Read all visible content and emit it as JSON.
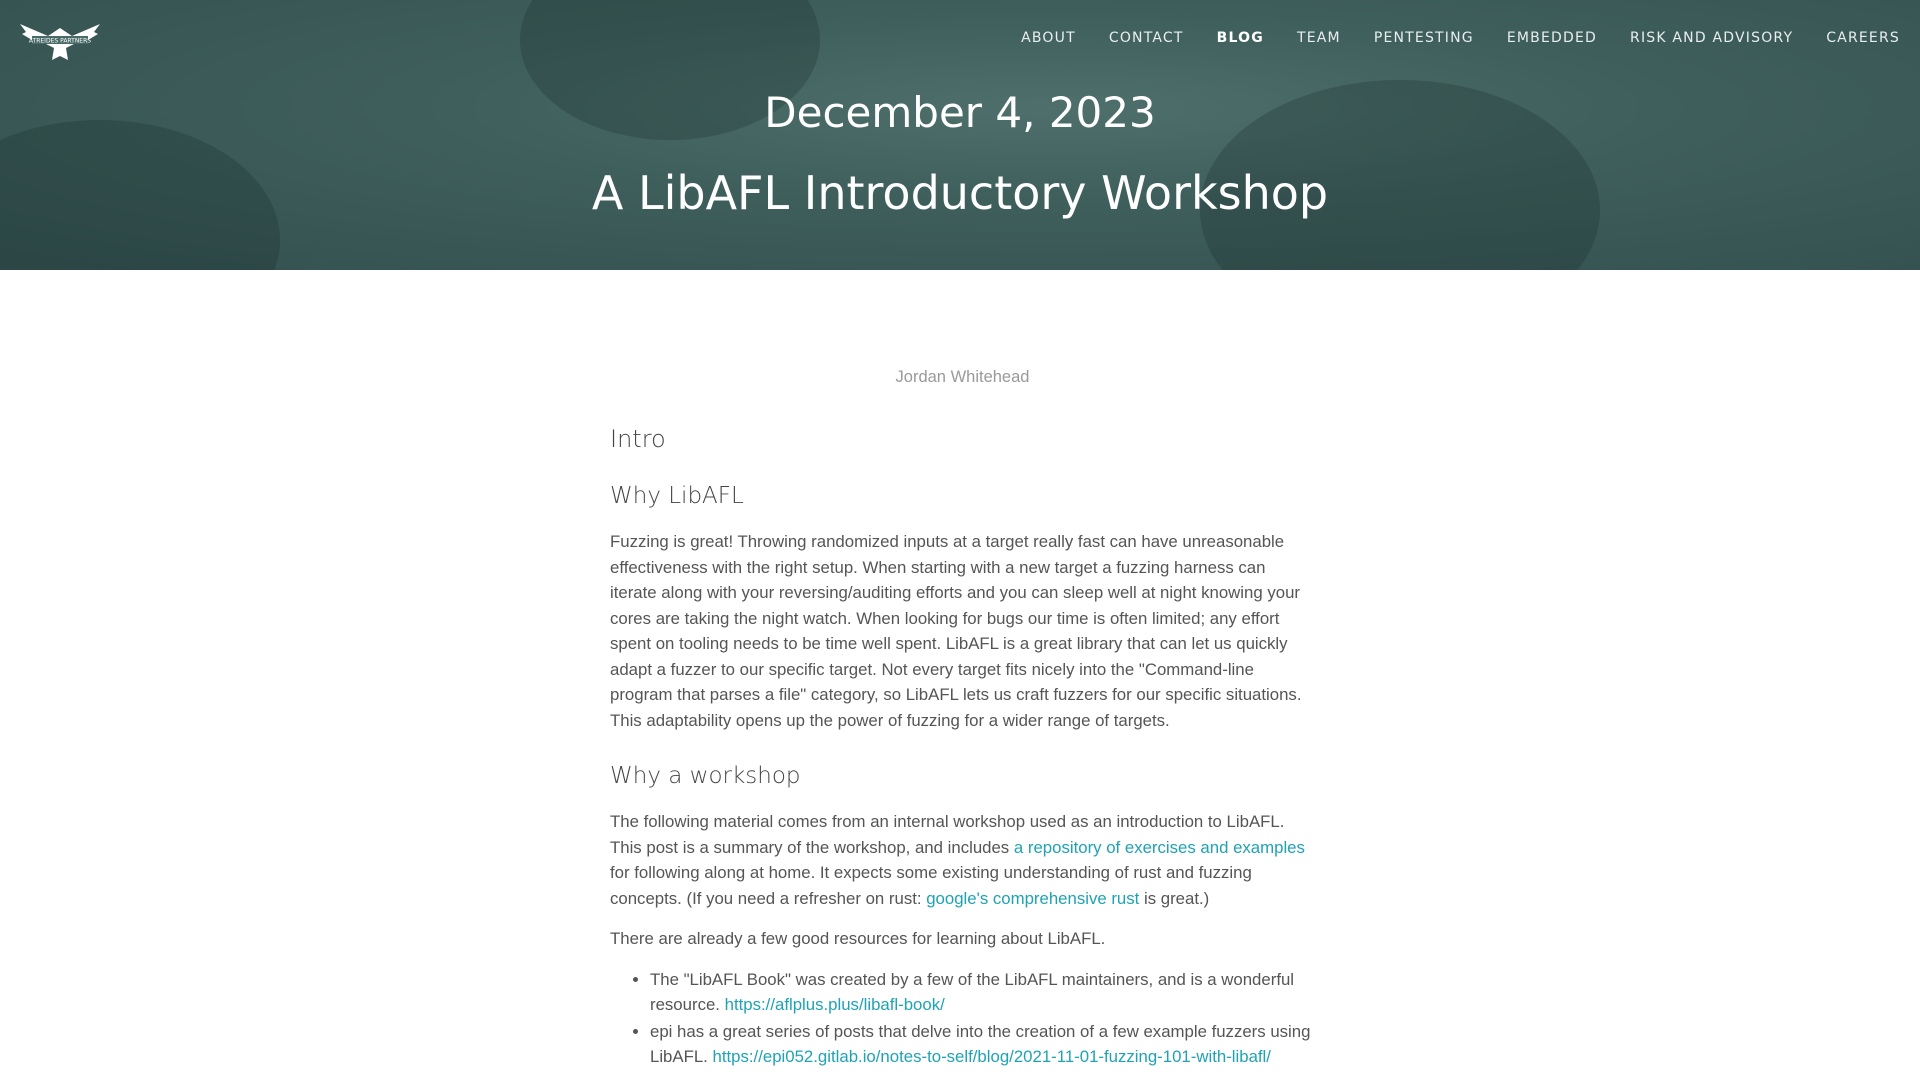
{
  "brand": {
    "logo_text": "ATREIDES PARTNERS"
  },
  "nav": [
    {
      "label": "ABOUT"
    },
    {
      "label": "CONTACT"
    },
    {
      "label": "BLOG",
      "active": true
    },
    {
      "label": "TEAM"
    },
    {
      "label": "PENTESTING"
    },
    {
      "label": "EMBEDDED"
    },
    {
      "label": "RISK AND ADVISORY"
    },
    {
      "label": "CAREERS"
    }
  ],
  "hero": {
    "date": "December 4, 2023",
    "title": "A LibAFL Introductory Workshop"
  },
  "post": {
    "author": "Jordan Whitehead",
    "h_intro": "Intro",
    "h_why_libafl": "Why LibAFL",
    "p1": "Fuzzing is great! Throwing randomized inputs at a target really fast can have unreasonable effectiveness with the right setup. When starting with a new target a fuzzing harness can iterate along with your reversing/auditing efforts and you can sleep well at night knowing your cores are taking the night watch. When looking for bugs our time is often limited; any effort spent on tooling needs to be time well spent. LibAFL is a great library that can let us quickly adapt a fuzzer to our specific target. Not every target fits nicely into the \"Command-line program that parses a file\" category, so LibAFL lets us craft fuzzers for our specific situations. This adaptability opens up the power of fuzzing for a wider range of targets.",
    "h_why_workshop": "Why a workshop",
    "p2a": "The following material comes from an internal workshop used as an introduction to LibAFL. This post is a summary of the workshop, and includes ",
    "p2_link1": "a repository of exercises and examples",
    "p2b": " for following along at home. It expects some existing understanding of rust and fuzzing concepts. (If you need a refresher on rust: ",
    "p2_link2": "google's comprehensive rust",
    "p2c": " is great.)",
    "p3": "There are already a few good resources for learning about LibAFL.",
    "list": [
      {
        "text": "The \"LibAFL Book\" was created by a few of the LibAFL maintainers, and is a wonderful resource. ",
        "link": "https://aflplus.plus/libafl-book/"
      },
      {
        "text": "epi has a great series of posts that delve into the creation of a few example fuzzers using LibAFL. ",
        "link": "https://epi052.gitlab.io/notes-to-self/blog/2021-11-01-fuzzing-101-with-libafl/"
      }
    ]
  },
  "colors": {
    "hero": "#3f5f5c",
    "link": "#1fa3b4",
    "text": "#555555"
  }
}
